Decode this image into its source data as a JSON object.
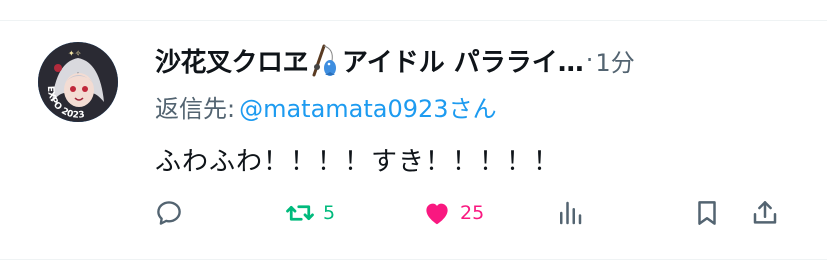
{
  "tweet": {
    "display_name": "沙花叉クロヱ",
    "display_name_tail": "アイドル パラライ…",
    "separator": "·",
    "time": "1分",
    "reply_prefix": "返信先:",
    "reply_handle": "@matamata0923さん",
    "text": "ふわふわ！！！！すき！！！！！",
    "avatar_badge_text": "EXPO 2023",
    "emoji": "fishing-pole-fish"
  },
  "actions": {
    "reply_count": "",
    "retweet_count": "5",
    "like_count": "25",
    "retweet_color": "#00ba7c",
    "like_color": "#f91880",
    "icon_color": "#536471"
  }
}
